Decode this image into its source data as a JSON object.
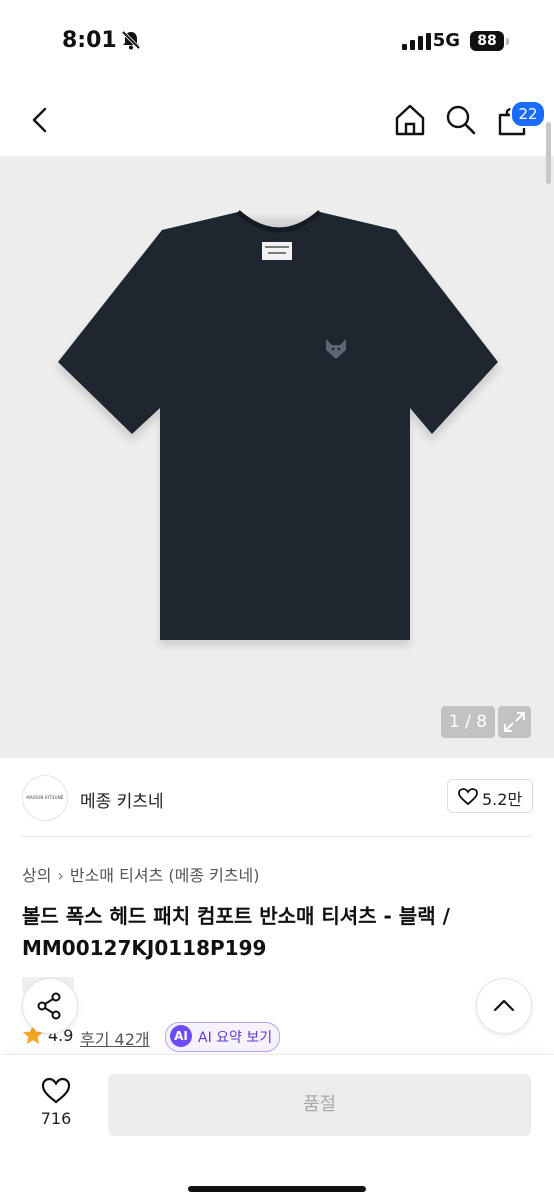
{
  "status_bar": {
    "time": "8:01",
    "network": "5G",
    "battery": "88"
  },
  "nav": {
    "cart_count": "22"
  },
  "gallery": {
    "counter": "1 / 8"
  },
  "brand": {
    "logo_text": "MAISON KITSUNÉ",
    "name": "메종 키츠네",
    "likes": "5.2만"
  },
  "breadcrumb": {
    "category": "상의",
    "subcategory": "반소매 티셔츠 (메종 키츠네)"
  },
  "product": {
    "title": "볼드 폭스 헤드 패치 컴포트 반소매 티셔츠 - 블랙 / MM00127KJ0118P199"
  },
  "rating": {
    "score": "4.9",
    "reviews": "후기 42개",
    "ai_badge": "AI",
    "ai_label": "AI 요약 보기"
  },
  "bottom_bar": {
    "wishlist_count": "716",
    "purchase_label": "품절"
  },
  "colors": {
    "accent": "#1a6bff",
    "shirt": "#1e2630",
    "ai_purple": "#6d4bff",
    "star": "#f5a623"
  }
}
